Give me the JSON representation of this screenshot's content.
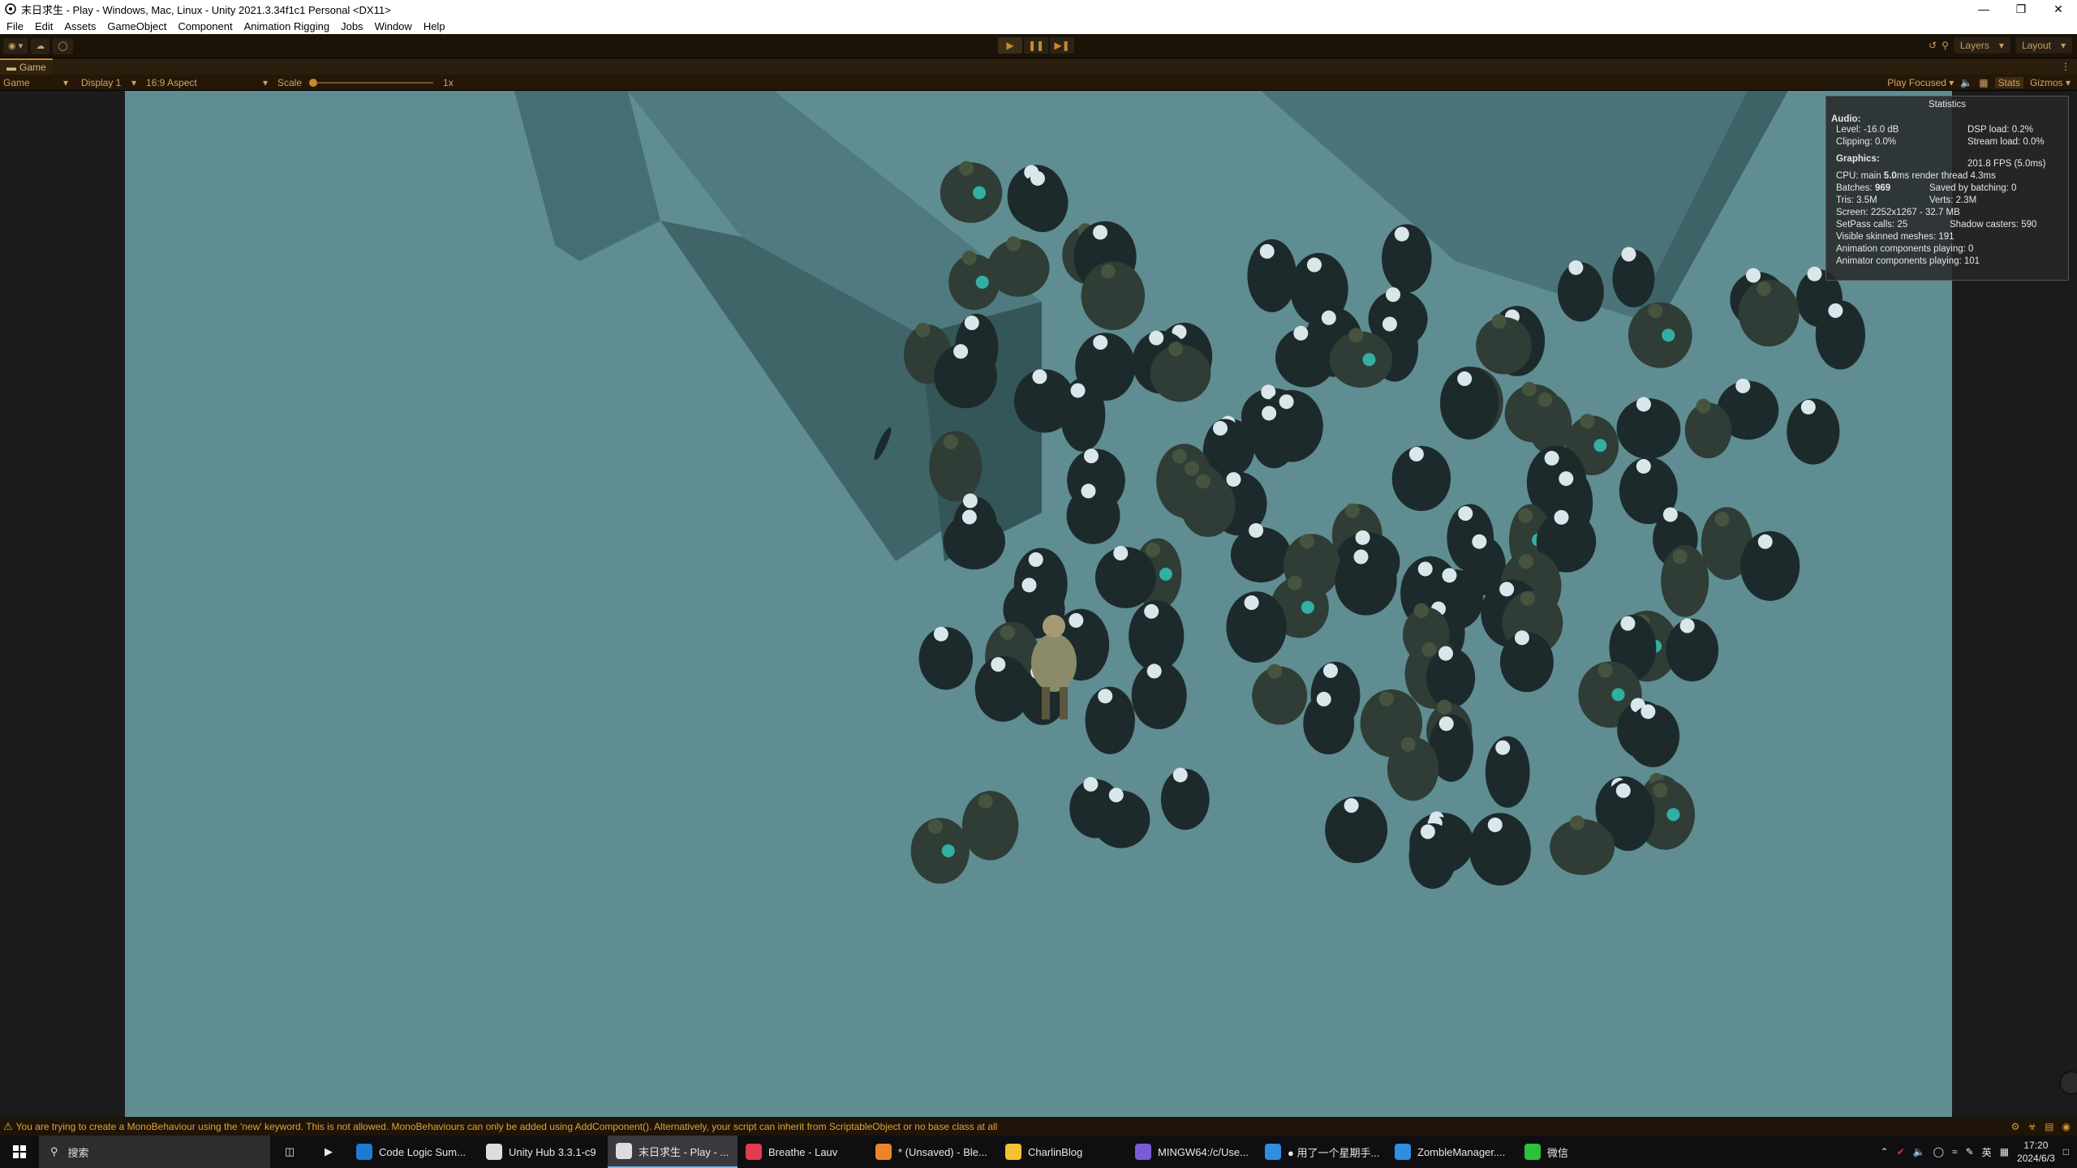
{
  "window": {
    "title": "末日求生 - Play - Windows, Mac, Linux - Unity 2021.3.34f1c1 Personal <DX11>",
    "controls": [
      "minimize-icon",
      "restore-icon",
      "close-icon"
    ]
  },
  "menu": [
    "File",
    "Edit",
    "Assets",
    "GameObject",
    "Component",
    "Animation Rigging",
    "Jobs",
    "Window",
    "Help"
  ],
  "toolbar": {
    "layers_label": "Layers",
    "layout_label": "Layout",
    "play_state": "playing"
  },
  "game_tab": {
    "label": "Game"
  },
  "game_bar": {
    "view_label": "Game",
    "display_label": "Display 1",
    "aspect_label": "16:9 Aspect",
    "scale_label": "Scale",
    "scale_value": "1x",
    "scale_fraction": 0.0,
    "play_focus_label": "Play Focused",
    "stats_label": "Stats",
    "gizmos_label": "Gizmos"
  },
  "stats": {
    "title": "Statistics",
    "audio_header": "Audio:",
    "level": "Level: -16.0 dB",
    "dsp_load": "DSP load: 0.2%",
    "clipping": "Clipping: 0.0%",
    "stream_load": "Stream load: 0.0%",
    "graphics_header": "Graphics:",
    "fps": "201.8 FPS (5.0ms)",
    "cpu_prefix": "CPU: main ",
    "cpu_main": "5.0",
    "cpu_suffix": "ms  render thread 4.3ms",
    "batches_prefix": "Batches: ",
    "batches_value": "969",
    "saved_batching": "Saved by batching: 0",
    "tris": "Tris: 3.5M",
    "verts": "Verts: 2.3M",
    "screen": "Screen: 2252x1267 - 32.7 MB",
    "setpass": "SetPass calls: 25",
    "shadow_casters": "Shadow casters: 590",
    "skinned_meshes": "Visible skinned meshes: 191",
    "animation_components": "Animation components playing: 0",
    "animator_components": "Animator components playing: 101"
  },
  "status_bar": {
    "message": "You are trying to create a MonoBehaviour using the 'new' keyword.  This is not allowed.  MonoBehaviours can only be added using AddComponent(). Alternatively, your script can inherit from ScriptableObject or no base class at all"
  },
  "taskbar": {
    "search_placeholder": "搜索",
    "tasks": [
      {
        "label": "Code Logic Sum...",
        "color": "#1f7ad6",
        "active": false
      },
      {
        "label": "Unity Hub 3.3.1-c9",
        "color": "#dddddd",
        "active": false
      },
      {
        "label": "末日求生 - Play - ...",
        "color": "#dddddd",
        "active": true
      },
      {
        "label": "Breathe - Lauv",
        "color": "#e23b4e",
        "active": false
      },
      {
        "label": "* (Unsaved) - Ble...",
        "color": "#e8862a",
        "active": false
      },
      {
        "label": "CharlinBlog",
        "color": "#f2c230",
        "active": false
      },
      {
        "label": "MINGW64:/c/Use...",
        "color": "#7b5cd6",
        "active": false
      },
      {
        "label": "● 用了一个星期手...",
        "color": "#2f8ee0",
        "active": false
      },
      {
        "label": "ZombleManager....",
        "color": "#2f8ee0",
        "active": false
      },
      {
        "label": "微信",
        "color": "#2fbf3a",
        "active": false
      }
    ],
    "tray_lang": "英",
    "time": "17:20",
    "date": "2024/6/3"
  }
}
